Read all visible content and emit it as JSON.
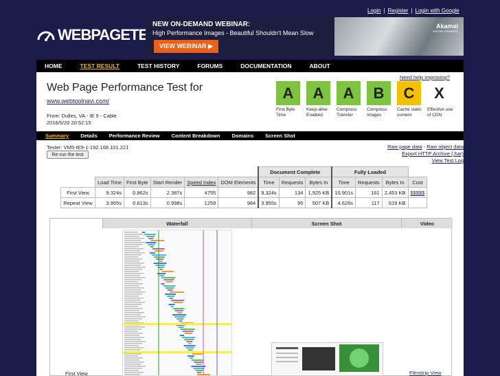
{
  "header": {
    "login": "Login",
    "register": "Register",
    "login_google": "Login with Google",
    "sep": "|",
    "logo_text": "WEBPAGETEST"
  },
  "banner": {
    "headline": "NEW ON-DEMAND WEBINAR:",
    "subline": "High Performance Images - Beautiful Shouldn't Mean Slow",
    "button": "VIEW WEBINAR ▶",
    "brand": "Akamai",
    "brand_tag": "FASTER FORWARD"
  },
  "nav": [
    "HOME",
    "TEST RESULT",
    "TEST HISTORY",
    "FORUMS",
    "DOCUMENTATION",
    "ABOUT"
  ],
  "page": {
    "title": "Web Page Performance Test for",
    "url": "www.webtoolnavi.com/",
    "from": "From: Dulles, VA - IE 9 - Cable",
    "date": "2016/5/20 20:52:15",
    "need_help": "Need help improving?"
  },
  "grades": [
    {
      "grade": "A",
      "label": "First Byte Time",
      "color": "#7dc241"
    },
    {
      "grade": "A",
      "label": "Keep-alive Enabled",
      "color": "#7dc241"
    },
    {
      "grade": "A",
      "label": "Compress Transfer",
      "color": "#7dc241"
    },
    {
      "grade": "B",
      "label": "Compress Images",
      "color": "#7dc241"
    },
    {
      "grade": "C",
      "label": "Cache static content",
      "color": "#f5c000"
    },
    {
      "grade": "X",
      "label": "Effective use of CDN",
      "color": "#ffffff"
    }
  ],
  "tabs": [
    "Summary",
    "Details",
    "Performance Review",
    "Content Breakdown",
    "Domains",
    "Screen Shot"
  ],
  "tester": {
    "text": "Tester: VM5-IE9-1-192.168.101.221",
    "rerun": "Re-run the test"
  },
  "right_links": {
    "raw_page": "Raw page data",
    "dash": " - ",
    "raw_object": "Raw object data",
    "har": "Export HTTP Archive (.har)",
    "log": "View Test Log"
  },
  "results": {
    "group_doc": "Document Complete",
    "group_full": "Fully Loaded",
    "columns": [
      "Load Time",
      "First Byte",
      "Start Render",
      "Speed Index",
      "DOM Elements",
      "Time",
      "Requests",
      "Bytes In",
      "Time",
      "Requests",
      "Bytes In",
      "Cost"
    ],
    "rows": [
      {
        "label": "First View",
        "cells": [
          "9.324s",
          "0.862s",
          "2.387s",
          "4755",
          "982",
          "9.324s",
          "134",
          "1,925 KB",
          "10.901s",
          "161",
          "2,453 KB",
          "$$$$$"
        ]
      },
      {
        "label": "Repeat View",
        "cells": [
          "3.955s",
          "0.613s",
          "0.998s",
          "1259",
          "984",
          "3.955s",
          "95",
          "507 KB",
          "4.626s",
          "117",
          "619 KB",
          ""
        ]
      }
    ]
  },
  "media": {
    "waterfall": "Waterfall",
    "screenshot": "Screen Shot",
    "video": "Video",
    "filmstrip": "Filmstrip View",
    "first_view": "First View"
  }
}
